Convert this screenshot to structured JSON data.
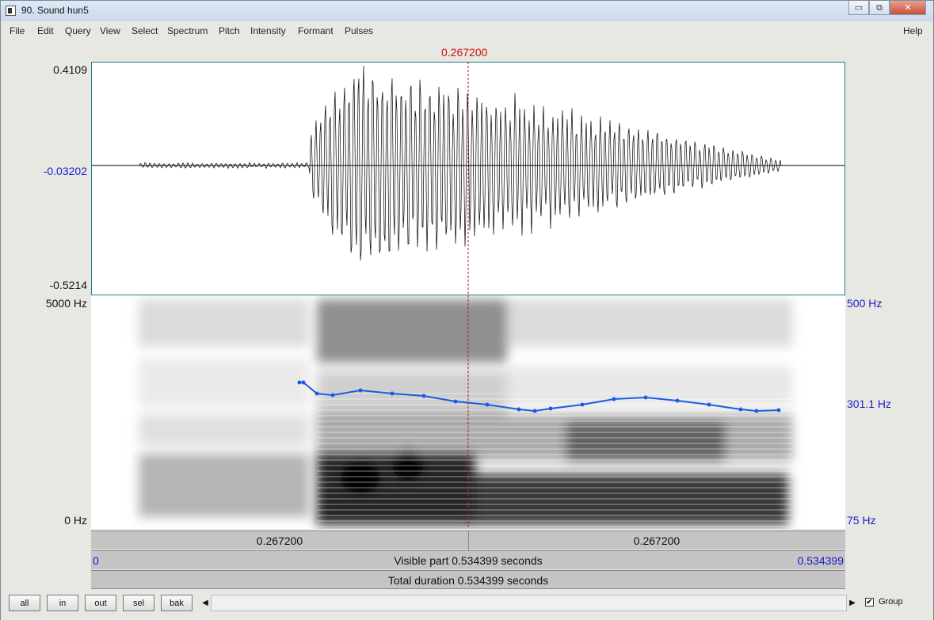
{
  "window": {
    "title": "90. Sound hun5",
    "controls": [
      "▭",
      "⧉",
      "✕"
    ]
  },
  "menu": {
    "items": [
      "File",
      "Edit",
      "Query",
      "View",
      "Select",
      "Spectrum",
      "Pitch",
      "Intensity",
      "Formant",
      "Pulses"
    ],
    "help": "Help"
  },
  "cursor": {
    "time_label": "0.267200"
  },
  "waveform": {
    "max_label": "0.4109",
    "zero_label": "-0.03202",
    "min_label": "-0.5214"
  },
  "spectrogram": {
    "top_freq": "5000 Hz",
    "bottom_freq": "0 Hz",
    "pitch_top": "500 Hz",
    "pitch_mid": "301.1 Hz",
    "pitch_bottom": "75 Hz",
    "pitch_color": "#1a5ce0"
  },
  "time_bars": {
    "left_segment": "0.267200",
    "right_segment": "0.267200",
    "visible_start": "0",
    "visible_text": "Visible part 0.534399 seconds",
    "visible_end": "0.534399",
    "total_text": "Total duration 0.534399 seconds"
  },
  "bottom_buttons": [
    "all",
    "in",
    "out",
    "sel",
    "bak"
  ],
  "group": {
    "label": "Group",
    "checked": "✔"
  },
  "scroll_arrows": {
    "left": "◀",
    "right": "▶"
  }
}
